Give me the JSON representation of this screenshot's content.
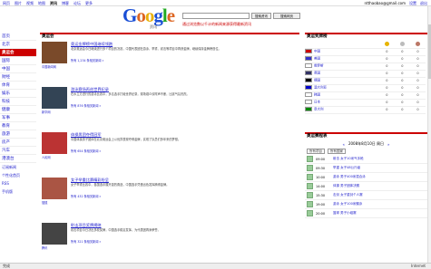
{
  "topnav": {
    "items": [
      "网页",
      "图片",
      "视频",
      "地图",
      "资讯",
      "博客",
      "论坛",
      "更多"
    ],
    "active_index": 4
  },
  "user": {
    "email": "ntthaobao@gmail.com",
    "settings": "设置",
    "signout": "退出"
  },
  "logo": {
    "text": "Google",
    "subtitle": "资讯"
  },
  "search": {
    "placeholder": "",
    "btn_search": "搜索资讯",
    "btn_web": "搜索网页"
  },
  "tagline": "通过浏览数以千计的新闻来源获得最新资讯",
  "leftnav": {
    "items": [
      "首页",
      "北京",
      "奥运会",
      "国际",
      "中国",
      "财经",
      "体育",
      "娱乐",
      "科技",
      "健康",
      "军事",
      "教育",
      "旅游",
      "房产",
      "汽车",
      "港澳台"
    ],
    "active_index": 2,
    "extras": [
      "订阅新闻",
      "个性化首页",
      "RSS",
      "手机版"
    ]
  },
  "main": {
    "section": "奥运会",
    "stories": [
      {
        "headline": "奥运金牌榜中国继续领跑",
        "caption": "中国新闻网",
        "snippet": "北京奥运会今日继续进行多个项目的决赛，中国代表团在游泳、举重、射击等项目中再获金牌，继续保持金牌榜首位。",
        "links": "所有 1,234 条相关新闻 »"
      },
      {
        "headline": "游泳赛场再创世界纪录",
        "caption": "新华网",
        "snippet": "在水立方进行的游泳比赛中，多名选手打破世界纪录，现场观众欢呼声不断，比赛气氛热烈。",
        "links": "所有 876 条相关新闻 »"
      },
      {
        "headline": "体操男团夺得冠军",
        "caption": "人民网",
        "snippet": "中国体操男子团体在北京奥运会上以优异表现夺得金牌，实现了队员们多年来的梦想。",
        "links": "所有 654 条相关新闻 »"
      },
      {
        "headline": "女子举重比赛精彩纷呈",
        "caption": "搜狐",
        "snippet": "女子举重比赛中，各国选手展开激烈角逐，中国选手凭借出色发挥摘得金牌。",
        "links": "所有 432 条相关新闻 »"
      },
      {
        "headline": "射击项目奖牌揭晓",
        "caption": "腾讯",
        "snippet": "射击项目今日决出多枚奖牌，中国选手稳定发挥，为代表团再添荣誉。",
        "links": "所有 321 条相关新闻 »"
      }
    ]
  },
  "medals": {
    "title": "奥运奖牌榜",
    "rows": [
      {
        "country": "中国",
        "flag": "#c00",
        "g": "0",
        "s": "0",
        "b": "0"
      },
      {
        "country": "美国",
        "flag": "#33c",
        "g": "0",
        "s": "0",
        "b": "0"
      },
      {
        "country": "俄罗斯",
        "flag": "#fff",
        "g": "0",
        "s": "0",
        "b": "0"
      },
      {
        "country": "英国",
        "flag": "#336",
        "g": "0",
        "s": "0",
        "b": "0"
      },
      {
        "country": "德国",
        "flag": "#000",
        "g": "0",
        "s": "0",
        "b": "0"
      },
      {
        "country": "澳大利亚",
        "flag": "#00c",
        "g": "0",
        "s": "0",
        "b": "0"
      },
      {
        "country": "韩国",
        "flag": "#fff",
        "g": "0",
        "s": "0",
        "b": "0"
      },
      {
        "country": "日本",
        "flag": "#fff",
        "g": "0",
        "s": "0",
        "b": "0"
      },
      {
        "country": "意大利",
        "flag": "#080",
        "g": "0",
        "s": "0",
        "b": "0"
      }
    ]
  },
  "schedule": {
    "title": "奥运赛程表",
    "date": "2008年8月10日 周日",
    "prev": "«",
    "next": "»",
    "select1": "所有项目",
    "select2": "所有国家",
    "rows": [
      {
        "time": "09:00",
        "text": "射击 女子10米气手枪"
      },
      {
        "time": "09:30",
        "text": "举重 女子48公斤级"
      },
      {
        "time": "10:00",
        "text": "游泳 男子400米混合泳"
      },
      {
        "time": "14:00",
        "text": "体操 男子团体决赛"
      },
      {
        "time": "15:30",
        "text": "击剑 女子重剑个人赛"
      },
      {
        "time": "19:00",
        "text": "游泳 女子100米蝶泳"
      },
      {
        "time": "20:00",
        "text": "篮球 男子小组赛"
      }
    ]
  },
  "status": {
    "left": "完成",
    "right": "Internet"
  }
}
